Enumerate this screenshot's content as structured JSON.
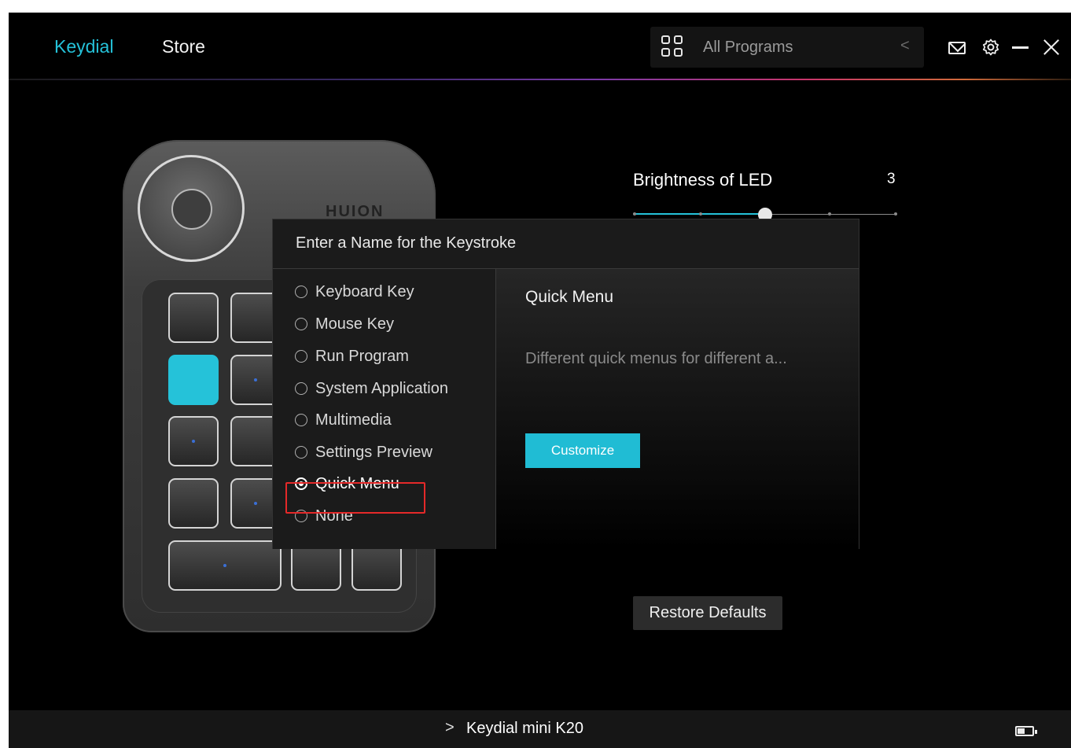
{
  "header": {
    "tabs": [
      {
        "label": "Keydial",
        "active": true
      },
      {
        "label": "Store",
        "active": false
      }
    ],
    "program_selector": {
      "label": "All Programs",
      "icon": "grid-icon",
      "back_icon": "chevron-left-icon"
    },
    "icons": [
      "mail-icon",
      "gear-icon",
      "minimize-icon",
      "close-icon"
    ],
    "accent_color": "#25c2d9"
  },
  "device": {
    "brand": "HUION",
    "selected_key_color": "#25c2d9"
  },
  "brightness": {
    "label": "Brightness of LED",
    "value": "3",
    "level_fraction": 0.5
  },
  "dialog": {
    "title": "Enter a Name for the Keystroke",
    "options": [
      {
        "label": "Keyboard Key",
        "selected": false
      },
      {
        "label": "Mouse Key",
        "selected": false
      },
      {
        "label": "Run Program",
        "selected": false
      },
      {
        "label": "System Application",
        "selected": false
      },
      {
        "label": "Multimedia",
        "selected": false
      },
      {
        "label": "Settings Preview",
        "selected": false
      },
      {
        "label": "Quick Menu",
        "selected": true
      },
      {
        "label": "None",
        "selected": false
      }
    ],
    "detail": {
      "title": "Quick Menu",
      "description": "Different quick menus for different a...",
      "button_label": "Customize"
    },
    "highlight_color": "#e52929"
  },
  "restore_label": "Restore Defaults",
  "footer": {
    "device_name": "Keydial mini K20",
    "battery_icon": "battery-icon"
  }
}
